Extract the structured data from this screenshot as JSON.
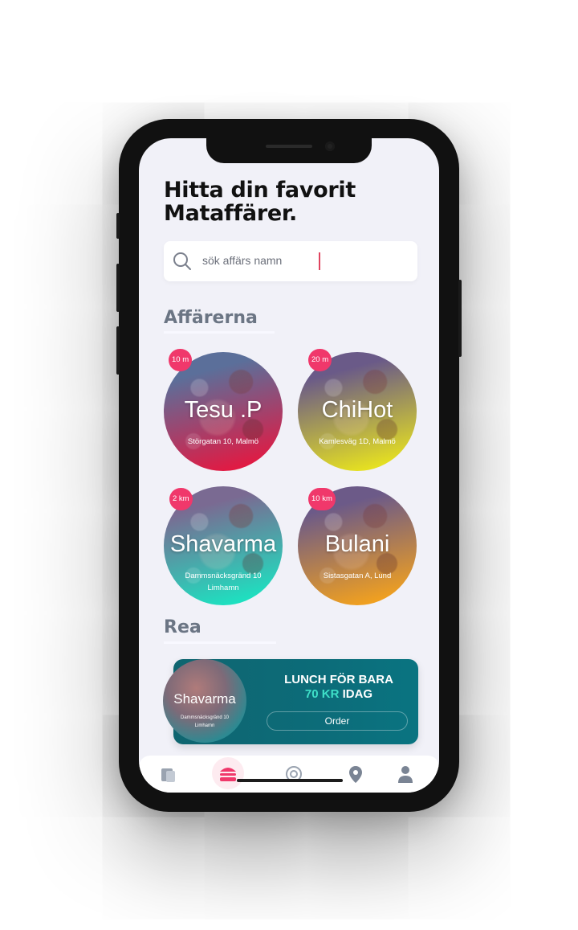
{
  "header": {
    "title_line1": "Hitta din favorit",
    "title_line2": "Mataffärer."
  },
  "search": {
    "placeholder": "sök affärs namn"
  },
  "sections": {
    "stores_title": "Affärerna",
    "sale_title": "Rea"
  },
  "stores": [
    {
      "name": "Tesu .P",
      "address": "Störgatan 10, Malmö",
      "distance": "10 m",
      "colors": [
        "#5b6f9a",
        "#e11a43"
      ]
    },
    {
      "name": "ChiHot",
      "address": "Kamlesväg 1D, Malmö",
      "distance": "20 m",
      "colors": [
        "#6a5a88",
        "#e5e021"
      ]
    },
    {
      "name": "Shavarma",
      "address": "Dammsnäcksgränd 10 Limhamn",
      "distance": "2 km",
      "colors": [
        "#7a6a92",
        "#1ee0c0"
      ]
    },
    {
      "name": "Bulani",
      "address": "Sistasgatan A, Lund",
      "distance": "10 km",
      "colors": [
        "#6c5a88",
        "#f0a020"
      ]
    }
  ],
  "promo": {
    "store_name": "Shavarma",
    "store_address": "Dammsnäcksgränd 10 Limhamn",
    "line1": "LUNCH FÖR BARA",
    "price": "70 KR",
    "line2_suffix": "IDAG",
    "order_label": "Order"
  },
  "tabbar": {
    "items": [
      {
        "icon": "receipt-icon"
      },
      {
        "icon": "burger-icon",
        "active": true
      },
      {
        "icon": "target-icon"
      },
      {
        "icon": "location-pin-icon"
      },
      {
        "icon": "user-icon"
      }
    ]
  },
  "colors": {
    "accent": "#f0386b",
    "promo_bg": "#0c6c79",
    "promo_highlight": "#3fe0c8"
  }
}
